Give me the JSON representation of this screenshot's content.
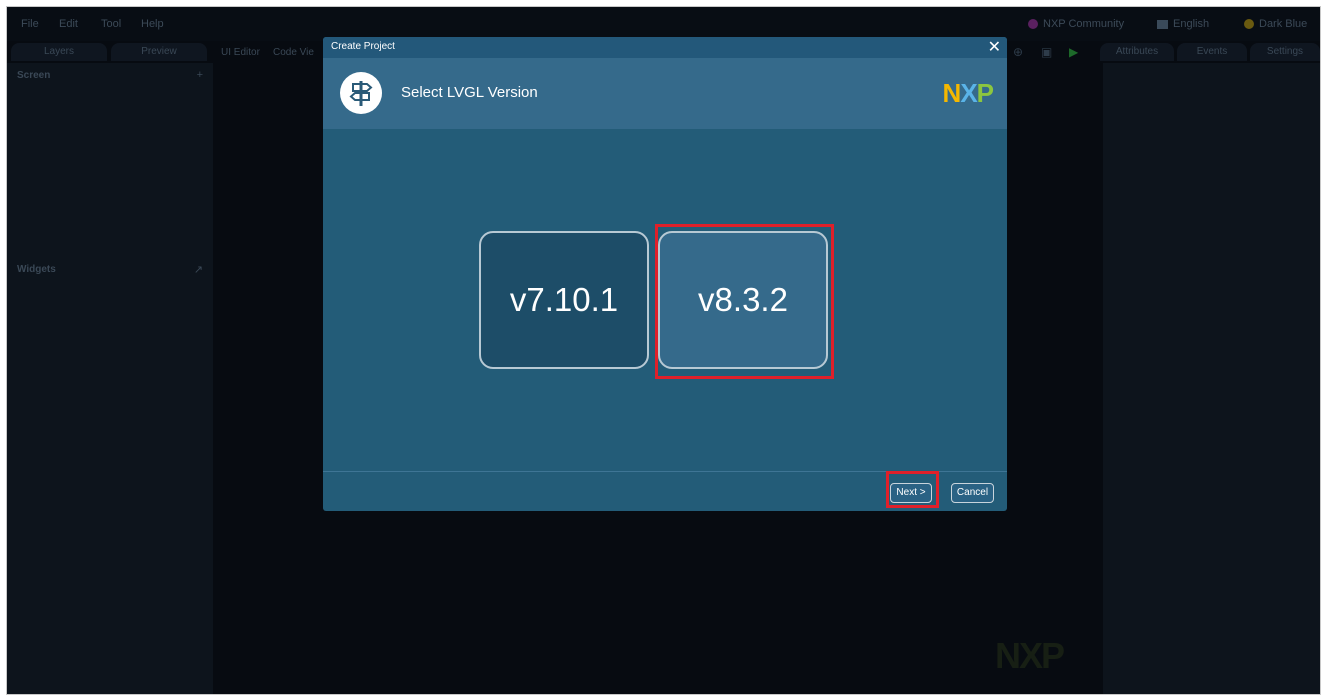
{
  "menubar": {
    "items": [
      "File",
      "Edit",
      "Tool",
      "Help"
    ],
    "community": "NXP Community",
    "language": "English",
    "theme": "Dark Blue"
  },
  "tabs": {
    "left": [
      "Layers",
      "Preview"
    ],
    "center": [
      "UI Editor",
      "Code Vie"
    ],
    "right": [
      "Attributes",
      "Events",
      "Settings"
    ]
  },
  "leftpanel": {
    "screen_label": "Screen",
    "widgets_label": "Widgets"
  },
  "dialog": {
    "title": "Create Project",
    "header_text": "Select LVGL Version",
    "logo": "NXP",
    "versions": [
      "v7.10.1",
      "v8.3.2"
    ],
    "selected_version": "v8.3.2",
    "next_label": "Next >",
    "cancel_label": "Cancel"
  },
  "colors": {
    "dialog_bg": "#235c78",
    "header_bg": "#356a8b",
    "highlight": "#e0202a",
    "logo_n": "#f5b800",
    "logo_x": "#5ab4e8",
    "logo_p": "#8cc63f"
  },
  "icons": [
    "signpost-icon",
    "close-icon",
    "plus-icon",
    "external-link-icon",
    "zoom-icon",
    "save-icon",
    "play-icon"
  ]
}
